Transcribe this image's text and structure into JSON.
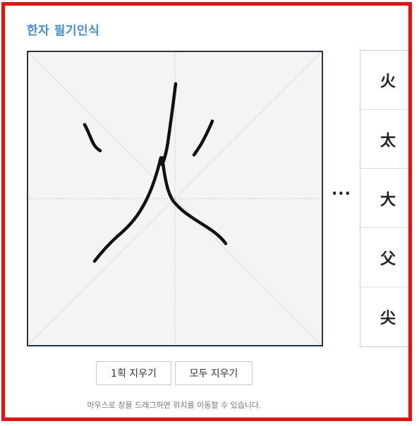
{
  "title": "한자 필기인식",
  "canvas": {
    "guides": "diagonal-and-cross"
  },
  "ellipsis": "···",
  "candidates": [
    "火",
    "太",
    "大",
    "父",
    "尖"
  ],
  "buttons": {
    "erase_stroke": "1획 지우기",
    "erase_all": "모두 지우기"
  },
  "hint": "마우스로 창을 드래그하면 위치를 이동할 수 있습니다.",
  "colors": {
    "title": "#3d8fe6",
    "frame_border": "#f20c0c",
    "canvas_bg": "#f4f4f4",
    "stroke": "#111111"
  }
}
